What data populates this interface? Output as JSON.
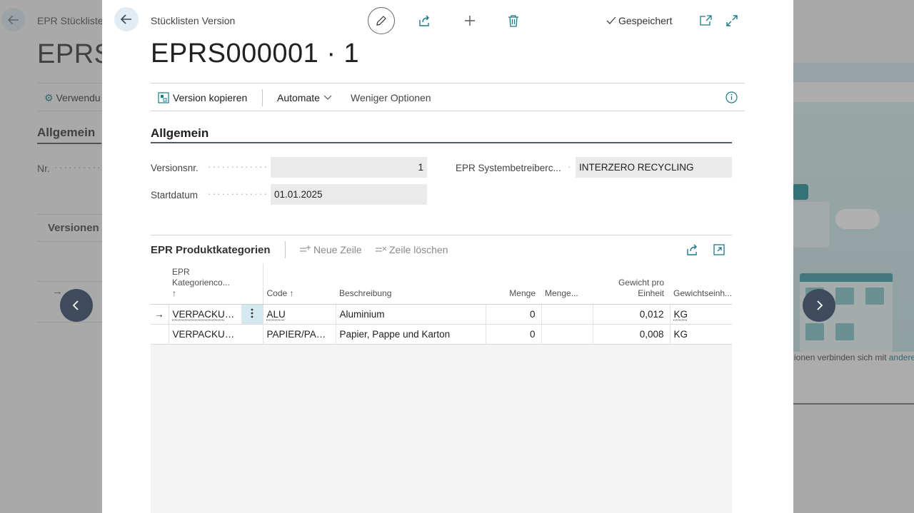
{
  "background": {
    "breadcrumb": "EPR Stückliste",
    "title_fragment": "EPRS0",
    "action_label": "Verwendu",
    "section": "Allgemein",
    "field_label": "Nr.",
    "field_dots": "··········",
    "versions_heading": "Versionen",
    "footer_text": "ionen verbinden sich mit ",
    "footer_link": "andere"
  },
  "dialog": {
    "breadcrumb": "Stücklisten Version",
    "title": "EPRS000001 · 1",
    "saved_label": "Gespeichert",
    "actions": {
      "copy_version": "Version kopieren",
      "automate": "Automate",
      "fewer_options": "Weniger Optionen"
    },
    "general": {
      "heading": "Allgemein",
      "version_label": "Versionsnr.",
      "version_value": "1",
      "start_label": "Startdatum",
      "start_value": "01.01.2025",
      "system_label": "EPR Systembetreiberc...",
      "system_value": "INTERZERO RECYCLING",
      "dots": "·············",
      "short_dots": "·"
    },
    "lines": {
      "title": "EPR Produktkategorien",
      "new_line": "Neue Zeile",
      "delete_line": "Zeile löschen",
      "columns": {
        "category_line1": "EPR",
        "category_line2": "Kategorienco...",
        "category_sort": "↑",
        "code": "Code ↑",
        "description": "Beschreibung",
        "quantity": "Menge",
        "quantity2": "Menge...",
        "weight_line1": "Gewicht pro",
        "weight_line2": "Einheit",
        "weight_unit": "Gewichtseinh..."
      },
      "rows": [
        {
          "indicator": "→",
          "category": "VERPACKUN...",
          "code": "ALU",
          "description": "Aluminium",
          "quantity": "0",
          "quantity2": "",
          "weight": "0,012",
          "unit": "KG"
        },
        {
          "indicator": "",
          "category": "VERPACKUN...",
          "code": "PAPIER/PAPP...",
          "description": "Papier, Pappe und Karton",
          "quantity": "0",
          "quantity2": "",
          "weight": "0,008",
          "unit": "KG"
        }
      ]
    }
  },
  "colors": {
    "accent": "#1b7a8a",
    "nav_circle": "#3f4a5c",
    "selected_cell": "#d3e9ef"
  }
}
